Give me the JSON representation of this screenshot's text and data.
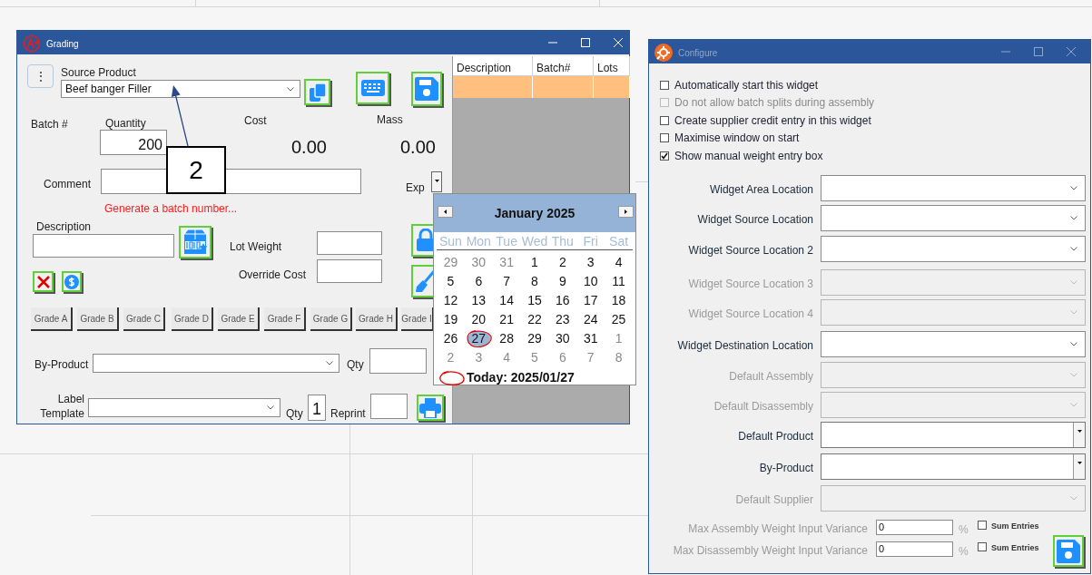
{
  "grading": {
    "title": "Grading",
    "menu_button": "⋮",
    "source_product": {
      "label": "Source Product",
      "value": "Beef banger Filler"
    },
    "batch_label": "Batch #",
    "quantity": {
      "label": "Quantity",
      "value": "200"
    },
    "cost": {
      "label": "Cost",
      "value": "0.00"
    },
    "mass": {
      "label": "Mass",
      "value": "0.00"
    },
    "comment": {
      "label": "Comment"
    },
    "exp_label": "Exp",
    "hint": "Generate a batch number...",
    "description": {
      "label": "Description"
    },
    "lot_weight": {
      "label": "Lot Weight"
    },
    "override_cost": {
      "label": "Override Cost"
    },
    "grade_buttons": [
      "Grade A",
      "Grade B",
      "Grade C",
      "Grade D",
      "Grade E",
      "Grade F",
      "Grade G",
      "Grade H",
      "Grade I"
    ],
    "by_product": {
      "label": "By-Product",
      "qty_label": "Qty"
    },
    "label_template": {
      "label": "Label Template",
      "qty_label": "Qty",
      "qty_value": "1",
      "reprint_label": "Reprint"
    },
    "grid": {
      "columns": [
        "Description",
        "Batch#",
        "Lots"
      ],
      "rows": [
        {
          "selected": true
        }
      ]
    }
  },
  "annotation": {
    "label": "2"
  },
  "calendar": {
    "month": "January 2025",
    "weekdays": [
      "Sun",
      "Mon",
      "Tue",
      "Wed",
      "Thu",
      "Fri",
      "Sat"
    ],
    "days": [
      {
        "day": "29",
        "current_month": false,
        "selected": false
      },
      {
        "day": "30",
        "current_month": false,
        "selected": false
      },
      {
        "day": "31",
        "current_month": false,
        "selected": false
      },
      {
        "day": "1",
        "current_month": true,
        "selected": false
      },
      {
        "day": "2",
        "current_month": true,
        "selected": false
      },
      {
        "day": "3",
        "current_month": true,
        "selected": false
      },
      {
        "day": "4",
        "current_month": true,
        "selected": false
      },
      {
        "day": "5",
        "current_month": true,
        "selected": false
      },
      {
        "day": "6",
        "current_month": true,
        "selected": false
      },
      {
        "day": "7",
        "current_month": true,
        "selected": false
      },
      {
        "day": "8",
        "current_month": true,
        "selected": false
      },
      {
        "day": "9",
        "current_month": true,
        "selected": false
      },
      {
        "day": "10",
        "current_month": true,
        "selected": false
      },
      {
        "day": "11",
        "current_month": true,
        "selected": false
      },
      {
        "day": "12",
        "current_month": true,
        "selected": false
      },
      {
        "day": "13",
        "current_month": true,
        "selected": false
      },
      {
        "day": "14",
        "current_month": true,
        "selected": false
      },
      {
        "day": "15",
        "current_month": true,
        "selected": false
      },
      {
        "day": "16",
        "current_month": true,
        "selected": false
      },
      {
        "day": "17",
        "current_month": true,
        "selected": false
      },
      {
        "day": "18",
        "current_month": true,
        "selected": false
      },
      {
        "day": "19",
        "current_month": true,
        "selected": false
      },
      {
        "day": "20",
        "current_month": true,
        "selected": false
      },
      {
        "day": "21",
        "current_month": true,
        "selected": false
      },
      {
        "day": "22",
        "current_month": true,
        "selected": false
      },
      {
        "day": "23",
        "current_month": true,
        "selected": false
      },
      {
        "day": "24",
        "current_month": true,
        "selected": false
      },
      {
        "day": "25",
        "current_month": true,
        "selected": false
      },
      {
        "day": "26",
        "current_month": true,
        "selected": false
      },
      {
        "day": "27",
        "current_month": true,
        "selected": true
      },
      {
        "day": "28",
        "current_month": true,
        "selected": false
      },
      {
        "day": "29",
        "current_month": true,
        "selected": false
      },
      {
        "day": "30",
        "current_month": true,
        "selected": false
      },
      {
        "day": "31",
        "current_month": true,
        "selected": false
      },
      {
        "day": "1",
        "current_month": false,
        "selected": false
      },
      {
        "day": "2",
        "current_month": false,
        "selected": false
      },
      {
        "day": "3",
        "current_month": false,
        "selected": false
      },
      {
        "day": "4",
        "current_month": false,
        "selected": false
      },
      {
        "day": "5",
        "current_month": false,
        "selected": false
      },
      {
        "day": "6",
        "current_month": false,
        "selected": false
      },
      {
        "day": "7",
        "current_month": false,
        "selected": false
      },
      {
        "day": "8",
        "current_month": false,
        "selected": false
      }
    ],
    "today": "Today: 2025/01/27"
  },
  "configure": {
    "title": "Configure",
    "options": [
      {
        "label": "Automatically start this widget",
        "checked": false,
        "disabled": false
      },
      {
        "label": "Do not allow batch splits during assembly",
        "checked": false,
        "disabled": true
      },
      {
        "label": "Create supplier credit entry in this widget",
        "checked": false,
        "disabled": false
      },
      {
        "label": "Maximise window on start",
        "checked": false,
        "disabled": false
      },
      {
        "label": "Show manual weight entry box",
        "checked": true,
        "disabled": false
      }
    ],
    "fields": [
      {
        "label": "Widget Area Location",
        "kind": "combo",
        "disabled": false
      },
      {
        "label": "Widget Source Location",
        "kind": "combo",
        "disabled": false
      },
      {
        "label": "Widget Source Location 2",
        "kind": "combo",
        "disabled": false
      },
      {
        "label": "Widget Source Location 3",
        "kind": "combo",
        "disabled": true
      },
      {
        "label": "Widget Source Location 4",
        "kind": "combo",
        "disabled": true
      },
      {
        "label": "Widget Destination Location",
        "kind": "combo",
        "disabled": false
      },
      {
        "label": "Default Assembly",
        "kind": "combo",
        "disabled": true
      },
      {
        "label": "Default Disassembly",
        "kind": "combo",
        "disabled": true
      },
      {
        "label": "Default Product",
        "kind": "dropdown",
        "disabled": false
      },
      {
        "label": "By-Product",
        "kind": "dropdown",
        "disabled": false
      },
      {
        "label": "Default Supplier",
        "kind": "combo",
        "disabled": true
      }
    ],
    "variances": [
      {
        "label": "Max Assembly Weight Input Variance",
        "value": "0",
        "unit": "%",
        "sum_label": "Sum Entries",
        "sum_checked": false
      },
      {
        "label": "Max Disassembly Weight Input Variance",
        "value": "0",
        "unit": "%",
        "sum_label": "Sum Entries",
        "sum_checked": false
      }
    ]
  }
}
